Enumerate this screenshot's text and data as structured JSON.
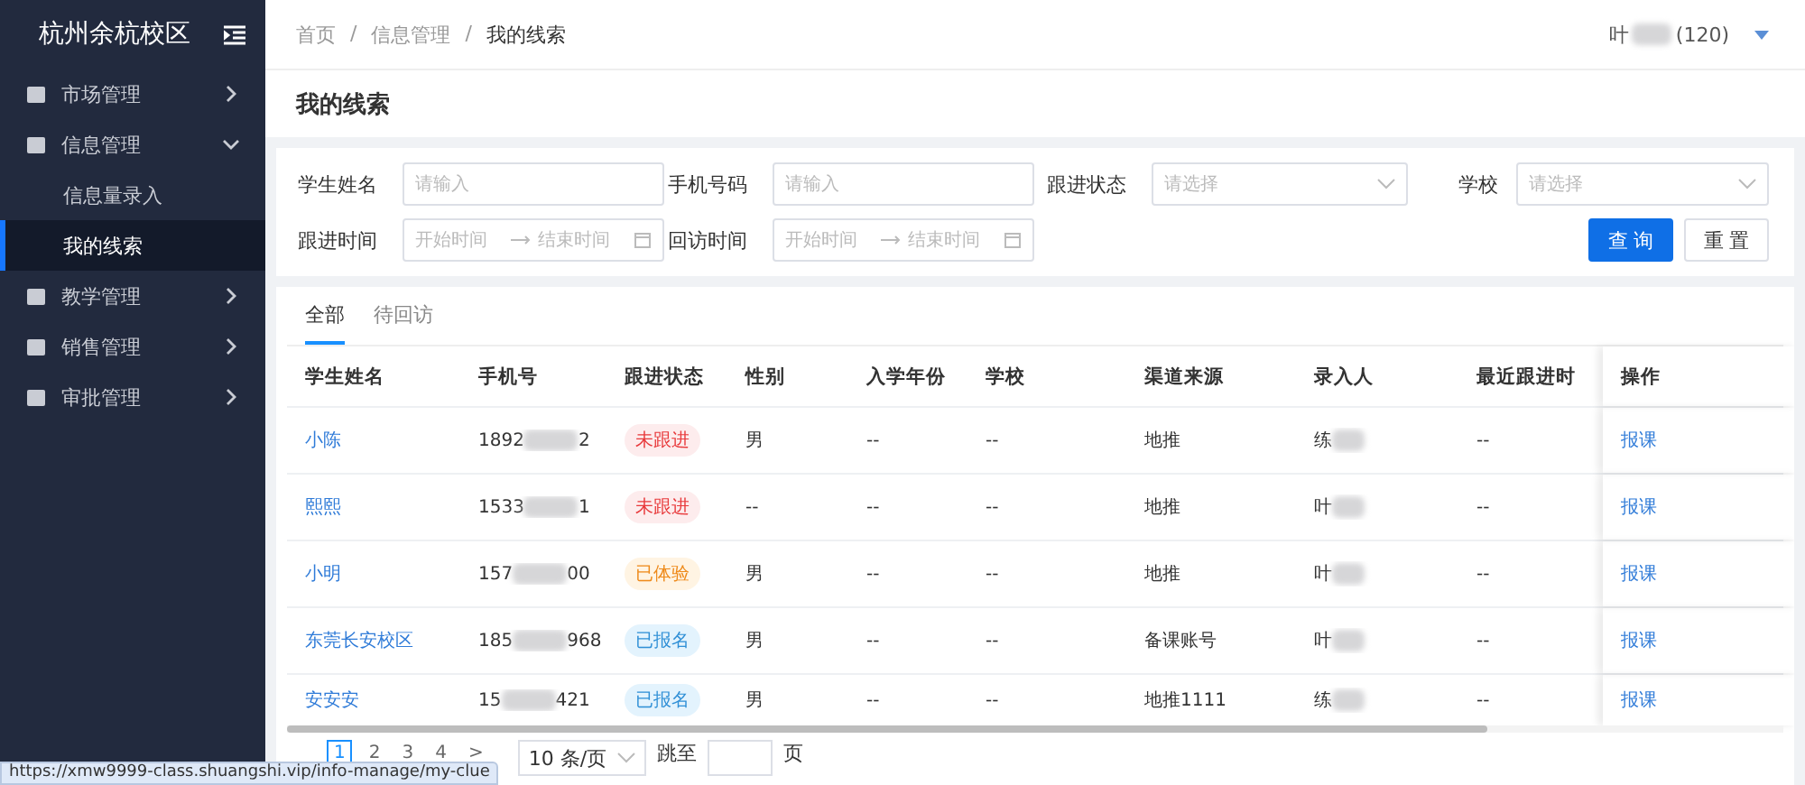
{
  "sidebar": {
    "title": "杭州余杭校区",
    "items": [
      {
        "label": "市场管理",
        "expanded": false
      },
      {
        "label": "信息管理",
        "expanded": true,
        "children": [
          {
            "label": "信息量录入",
            "selected": false
          },
          {
            "label": "我的线索",
            "selected": true
          }
        ]
      },
      {
        "label": "教学管理",
        "expanded": false
      },
      {
        "label": "销售管理",
        "expanded": false
      },
      {
        "label": "审批管理",
        "expanded": false
      }
    ]
  },
  "breadcrumb": [
    "首页",
    "信息管理",
    "我的线索"
  ],
  "breadcrumb_separator": "/",
  "user": {
    "name_visible": "叶",
    "suffix": "(120)"
  },
  "page_title": "我的线索",
  "filters": [
    {
      "label": "学生姓名",
      "kind": "text",
      "placeholder": "请输入"
    },
    {
      "label": "手机号码",
      "kind": "text",
      "placeholder": "请输入"
    },
    {
      "label": "跟进状态",
      "kind": "select",
      "placeholder": "请选择"
    },
    {
      "label": "学校",
      "kind": "select",
      "placeholder": "请选择"
    },
    {
      "label": "跟进时间",
      "kind": "range",
      "start": "开始时间",
      "end": "结束时间"
    },
    {
      "label": "回访时间",
      "kind": "range",
      "start": "开始时间",
      "end": "结束时间"
    }
  ],
  "buttons": [
    {
      "label": "查 询",
      "kind": "primary"
    },
    {
      "label": "重 置",
      "kind": "default"
    }
  ],
  "tabs": [
    {
      "label": "全部",
      "selected": true
    },
    {
      "label": "待回访",
      "selected": false
    }
  ],
  "table": {
    "columns": [
      "学生姓名",
      "手机号",
      "跟进状态",
      "性别",
      "入学年份",
      "学校",
      "渠道来源",
      "录入人",
      "最近跟进时",
      "操作"
    ],
    "rows": [
      {
        "name": "小陈",
        "phone_start": "1892",
        "phone_end": "2",
        "status": "未跟进",
        "kind": "pending",
        "gender": "男",
        "year": "--",
        "school": "--",
        "channel": "地推",
        "entered_by": "练",
        "last_follow": "--",
        "action": "报课"
      },
      {
        "name": "熙熙",
        "phone_start": "1533",
        "phone_end": "1",
        "status": "未跟进",
        "kind": "pending",
        "gender": "--",
        "year": "--",
        "school": "--",
        "channel": "地推",
        "entered_by": "叶",
        "last_follow": "--",
        "action": "报课"
      },
      {
        "name": "小明",
        "phone_start": "157",
        "phone_end": "00",
        "status": "已体验",
        "kind": "trial",
        "gender": "男",
        "year": "--",
        "school": "--",
        "channel": "地推",
        "entered_by": "叶",
        "last_follow": "--",
        "action": "报课"
      },
      {
        "name": "东莞长安校区",
        "phone_start": "185",
        "phone_end": "968",
        "status": "已报名",
        "kind": "enrolled",
        "gender": "男",
        "year": "--",
        "school": "--",
        "channel": "备课账号",
        "entered_by": "叶",
        "last_follow": "--",
        "action": "报课"
      },
      {
        "name": "安安安",
        "phone_start": "15",
        "phone_end": "421",
        "status": "已报名",
        "kind": "enrolled",
        "gender": "男",
        "year": "--",
        "school": "--",
        "channel": "地推1111",
        "entered_by": "练",
        "last_follow": "--",
        "action": "报课"
      }
    ]
  },
  "pagination": {
    "pages": [
      {
        "label": "1",
        "selected": true
      },
      {
        "label": "2",
        "selected": false
      },
      {
        "label": "3",
        "selected": false
      },
      {
        "label": "4",
        "selected": false
      }
    ],
    "next": ">",
    "page_size": "10 条/页",
    "jump_label": "跳至",
    "jump_suffix": "页"
  },
  "status_url": "https://xmw9999-class.shuangshi.vip/info-manage/my-clue"
}
